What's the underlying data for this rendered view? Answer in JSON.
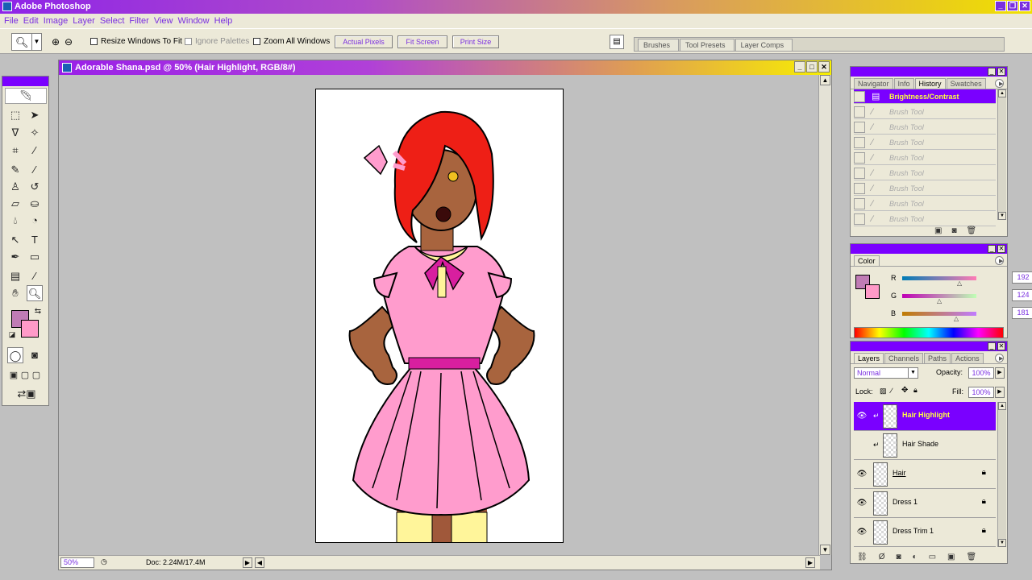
{
  "app": {
    "title": "Adobe Photoshop"
  },
  "menu": [
    "File",
    "Edit",
    "Image",
    "Layer",
    "Select",
    "Filter",
    "View",
    "Window",
    "Help"
  ],
  "options": {
    "resize_windows": "Resize Windows To Fit",
    "ignore_palettes": "Ignore Palettes",
    "zoom_all": "Zoom All Windows",
    "actual_pixels": "Actual Pixels",
    "fit_screen": "Fit Screen",
    "print_size": "Print Size"
  },
  "well_tabs": [
    "Brushes",
    "Tool Presets",
    "Layer Comps"
  ],
  "document": {
    "title": "Adorable Shana.psd @ 50% (Hair Highlight, RGB/8#)",
    "zoom": "50%",
    "doc_info": "Doc: 2.24M/17.4M"
  },
  "history": {
    "tabs": [
      "Navigator",
      "Info",
      "History",
      "Swatches"
    ],
    "items": [
      {
        "label": "Brightness/Contrast",
        "selected": true
      },
      {
        "label": "Brush Tool"
      },
      {
        "label": "Brush Tool"
      },
      {
        "label": "Brush Tool"
      },
      {
        "label": "Brush Tool"
      },
      {
        "label": "Brush Tool"
      },
      {
        "label": "Brush Tool"
      },
      {
        "label": "Brush Tool"
      },
      {
        "label": "Brush Tool"
      }
    ]
  },
  "color": {
    "tab": "Color",
    "r_label": "R",
    "g_label": "G",
    "b_label": "B",
    "r": "192",
    "g": "124",
    "b": "181",
    "foreground": "#c07cb5",
    "background": "#ff9ac8"
  },
  "layers": {
    "tabs": [
      "Layers",
      "Channels",
      "Paths",
      "Actions"
    ],
    "blend_mode": "Normal",
    "opacity_label": "Opacity:",
    "opacity": "100%",
    "lock_label": "Lock:",
    "fill_label": "Fill:",
    "fill": "100%",
    "items": [
      {
        "name": "Hair Highlight",
        "selected": true
      },
      {
        "name": "Hair Shade"
      },
      {
        "name": "Hair"
      },
      {
        "name": "Dress 1"
      },
      {
        "name": "Dress Trim 1"
      }
    ]
  },
  "accent": "#7a00ff"
}
